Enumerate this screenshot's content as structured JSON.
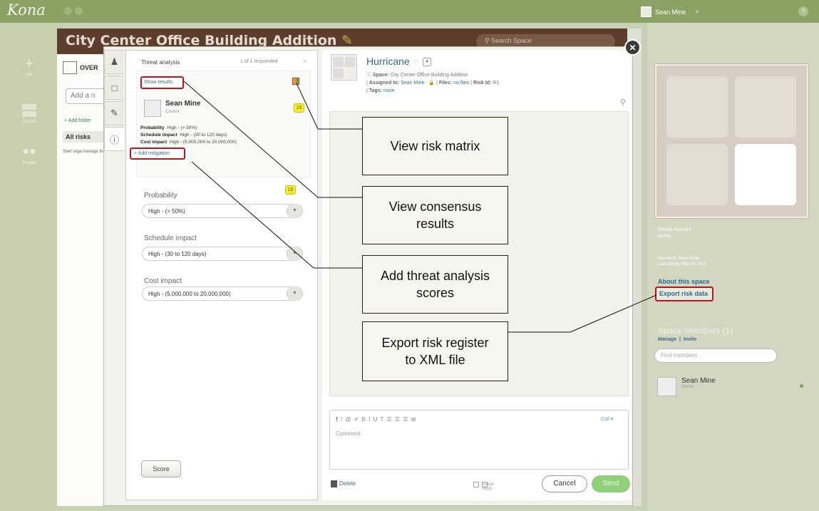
{
  "app": {
    "logo": "Kona",
    "user_name": "Sean Mine",
    "user_caret": "▾",
    "help": "?"
  },
  "rail": {
    "items": [
      {
        "label": "Add",
        "icon": "plus-icon"
      },
      {
        "label": "Spaces",
        "icon": "grid-icon"
      },
      {
        "label": "People",
        "icon": "people-icon"
      }
    ]
  },
  "space": {
    "title": "City Center Office Building Addition",
    "search_placeholder": "Search Space",
    "overview": "OVER",
    "add_input_placeholder": "Add a n",
    "add_folder": "+ Add folder",
    "all_risks": "All risks",
    "start_text": "Start orga manage the thing"
  },
  "threat": {
    "title": "Threat analysis",
    "count": "1 of 1 responded",
    "close": "×",
    "show_results": "Show results",
    "user_name": "Sean Mine",
    "user_role": "Creator",
    "score": "16",
    "lines": [
      {
        "label": "Probability",
        "value": "High - (> 50%)"
      },
      {
        "label": "Schedule impact",
        "value": "High - (30 to 120 days)"
      },
      {
        "label": "Cost impact",
        "value": "High - (5,000,000 to 20,000,000)"
      }
    ],
    "add_mitigation": "+ Add mitigation",
    "fields": [
      {
        "label": "Probability",
        "value": "High - (> 50%)"
      },
      {
        "label": "Schedule impact",
        "value": "High - (30 to 120 days)"
      },
      {
        "label": "Cost impact",
        "value": "High - (5,000,000 to 20,000,000)"
      }
    ],
    "field_score": "16",
    "score_button": "Score"
  },
  "risk": {
    "title": "Hurricane",
    "space_label": "Space:",
    "space_value": "City Center Office Building Addition",
    "assigned_label": "Assigned to:",
    "assigned_value": "Sean Mine",
    "files_label": "Files:",
    "files_value": "no files",
    "riskid_label": "Risk Id:",
    "riskid_value": "R1",
    "tags_label": "Tags:",
    "tags_value": "none",
    "toolbar": "!  @  ✐   B  I  U  T   ☰  ☰  ☰  ⊞",
    "call": "Call ▾",
    "comment_placeholder": "Comment",
    "delete": "Delete",
    "quick_reply": "Quick reply",
    "cancel": "Cancel",
    "send": "Send"
  },
  "sidebar": {
    "account_name": "Deltek Account",
    "account_type": "WORK",
    "owned_by": "Owned by Sean Mine",
    "last_activity": "Last activity May 16 2014",
    "about": "About this space",
    "export": "Export risk data",
    "members_title": "Space Members (1)",
    "manage": "Manage",
    "invite": "Invite",
    "find_placeholder": "Find members",
    "member_name": "Sean Mine",
    "member_role": "Owner"
  },
  "callouts": {
    "matrix": "View risk matrix",
    "consensus": "View consensus results",
    "scores": "Add threat analysis scores",
    "export": "Export risk register to XML file"
  },
  "colors": {
    "topbar": "#8aa365",
    "board_header": "#5d3d2b",
    "highlight": "#c1121f",
    "link": "#2b6a8e",
    "score_badge": "#f5ef2a",
    "send": "#8fd07a"
  }
}
